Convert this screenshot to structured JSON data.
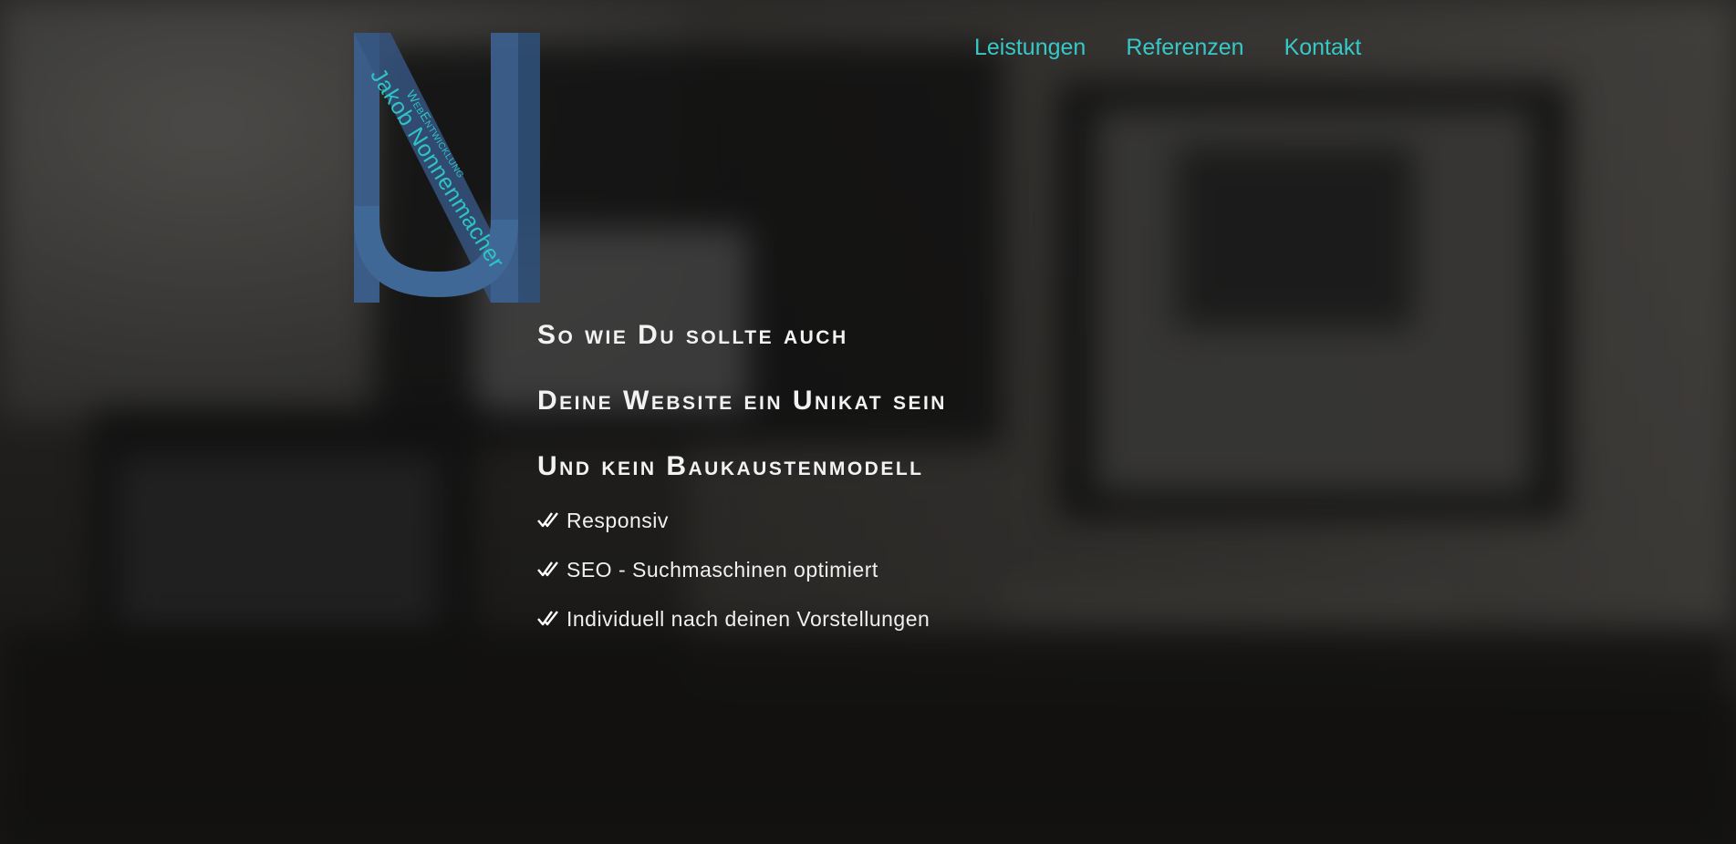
{
  "logo": {
    "name": "Jakob Nonnenmacher",
    "subtitle": "WebEntwicklung",
    "color_primary": "#3c5f8c",
    "color_text": "#2ec4c4"
  },
  "nav": {
    "items": [
      {
        "label": "Leistungen"
      },
      {
        "label": "Referenzen"
      },
      {
        "label": "Kontakt"
      }
    ],
    "color": "#37c8c8"
  },
  "hero": {
    "headlines": [
      "So wie Du sollte auch",
      "Deine Website ein Unikat sein",
      "Und kein Baukaustenmodell"
    ],
    "features": [
      {
        "icon": "double-check-icon",
        "text": "Responsiv"
      },
      {
        "icon": "double-check-icon",
        "text": "SEO - Suchmaschinen optimiert"
      },
      {
        "icon": "double-check-icon",
        "text": "Individuell nach deinen Vorstellungen"
      }
    ]
  }
}
